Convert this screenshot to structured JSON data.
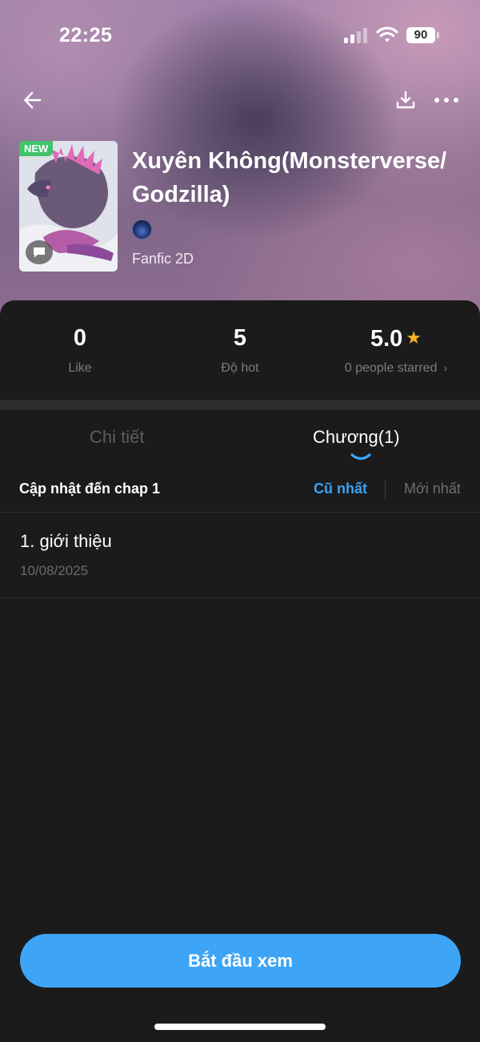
{
  "status_bar": {
    "time": "22:25",
    "battery_level": "90",
    "signal_bars_active": 2,
    "signal_bars_total": 4
  },
  "header": {
    "back_icon": "arrow-left-icon",
    "download_icon": "download-icon",
    "more_icon": "more-horizontal-icon"
  },
  "book": {
    "badge": "NEW",
    "title": "Xuyên Không(Monsterverse/ Godzilla)",
    "genre": "Fanfic 2D"
  },
  "stats": {
    "like_value": "0",
    "like_label": "Like",
    "hot_value": "5",
    "hot_label": "Độ hot",
    "rating_value": "5.0",
    "rating_label": "0 people starred",
    "rating_chevron": "›"
  },
  "tabs": {
    "detail": "Chi tiết",
    "chapters": "Chương(1)"
  },
  "chapter_list": {
    "update_label": "Cập nhật đến chap 1",
    "sort_oldest": "Cũ nhất",
    "sort_newest": "Mới nhất",
    "items": [
      {
        "title": "1. giới thiệu",
        "date": "10/08/2025"
      }
    ]
  },
  "actions": {
    "start_reading": "Bắt đầu xem"
  },
  "colors": {
    "accent": "#3ea5f6",
    "background": "#1b1b1c",
    "new_badge": "#3fc46b",
    "star": "#f5b324"
  }
}
